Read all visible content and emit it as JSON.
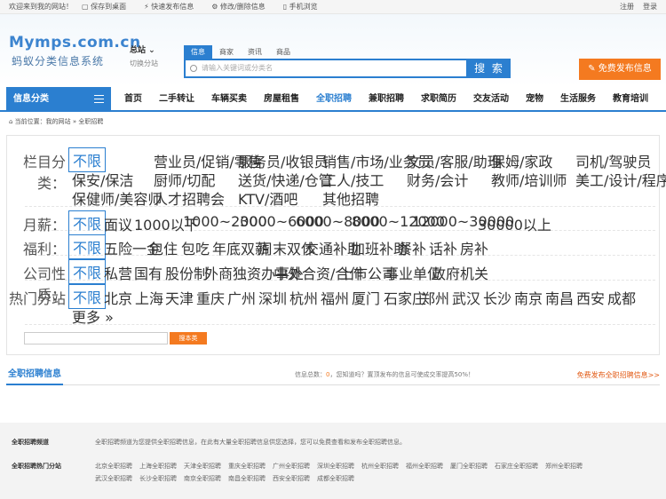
{
  "topbar": {
    "welcome": "欢迎来到我的网站！",
    "save_desktop": "保存到桌面",
    "quick_post": "快速发布信息",
    "edit_delete": "修改/删除信息",
    "mobile": "手机浏览",
    "register": "注册",
    "login": "登录"
  },
  "header": {
    "logo_en": "Mymps.com.cn",
    "logo_cn": "蚂蚁分类信息系统",
    "city": "总站",
    "city_switch": "切换分站",
    "search_tabs": [
      "信息",
      "商家",
      "资讯",
      "商品"
    ],
    "search_placeholder": "请输入关键词或分类名",
    "search_button": "搜 索",
    "post_button": "免费发布信息"
  },
  "nav": {
    "category_label": "信息分类",
    "items": [
      "首页",
      "二手转让",
      "车辆买卖",
      "房屋租售",
      "全职招聘",
      "兼职招聘",
      "求职简历",
      "交友活动",
      "宠物",
      "生活服务",
      "教育培训"
    ],
    "active_index": 4
  },
  "breadcrumb": "当前位置：我的网站 » 全职招聘",
  "filter": {
    "column": {
      "label": "栏目分类：",
      "all": "不限",
      "items": [
        "营业员/促销/零售",
        "服务员/收银员",
        "销售/市场/业务员",
        "文员/客服/助理",
        "保姆/家政",
        "司机/驾驶员",
        "保安/保洁",
        "厨师/切配",
        "送货/快递/仓管",
        "工人/技工",
        "财务/会计",
        "教师/培训师",
        "美工/设计/程序员",
        "保健师/美容师",
        "人才招聘会",
        "KTV/酒吧",
        "其他招聘"
      ]
    },
    "salary": {
      "label": "月薪：",
      "all": "不限",
      "items": [
        "面议",
        "1000以下",
        "1000~2000",
        "3000~6000",
        "6000~8000",
        "8000~12000",
        "12000~30000",
        "30000以上"
      ]
    },
    "welfare": {
      "label": "福利：",
      "all": "不限",
      "items": [
        "五险一金",
        "包住",
        "包吃",
        "年底双薪",
        "周末双休",
        "交通补助",
        "加班补助",
        "餐补",
        "话补",
        "房补"
      ]
    },
    "company": {
      "label": "公司性质：",
      "all": "不限",
      "items": [
        "私营",
        "国有",
        "股份制",
        "外商独资办事处",
        "中外合资/合作",
        "上市公司",
        "事业单位",
        "政府机关"
      ]
    },
    "city": {
      "label": "热门分站",
      "all": "不限",
      "items": [
        "北京",
        "上海",
        "天津",
        "重庆",
        "广州",
        "深圳",
        "杭州",
        "福州",
        "厦门",
        "石家庄",
        "郑州",
        "武汉",
        "长沙",
        "南京",
        "南昌",
        "西安",
        "成都"
      ],
      "more": "更多 »"
    },
    "keyword_button": "搜本类"
  },
  "list": {
    "title": "全职招聘信息",
    "info_prefix": "信息总数：",
    "count": "0",
    "info_suffix": "，您知道吗？置顶发布的信息可使成交率提高50%！",
    "post_link": "免费发布全职招聘信息>>"
  },
  "footer": {
    "channel_label": "全职招聘频道",
    "channel_text": "全职招聘频道为您提供全职招聘信息，在此有大量全职招聘信息供您选择，您可以免费查看和发布全职招聘信息。",
    "hot_label": "全职招聘热门分站",
    "hot_links": [
      "北京全职招聘",
      "上海全职招聘",
      "天津全职招聘",
      "重庆全职招聘",
      "广州全职招聘",
      "深圳全职招聘",
      "杭州全职招聘",
      "福州全职招聘",
      "厦门全职招聘",
      "石家庄全职招聘",
      "郑州全职招聘",
      "武汉全职招聘",
      "长沙全职招聘",
      "南京全职招聘",
      "南昌全职招聘",
      "西安全职招聘",
      "成都全职招聘"
    ]
  },
  "colors": {
    "brand": "#2b7fd0",
    "accent": "#f47a20"
  }
}
